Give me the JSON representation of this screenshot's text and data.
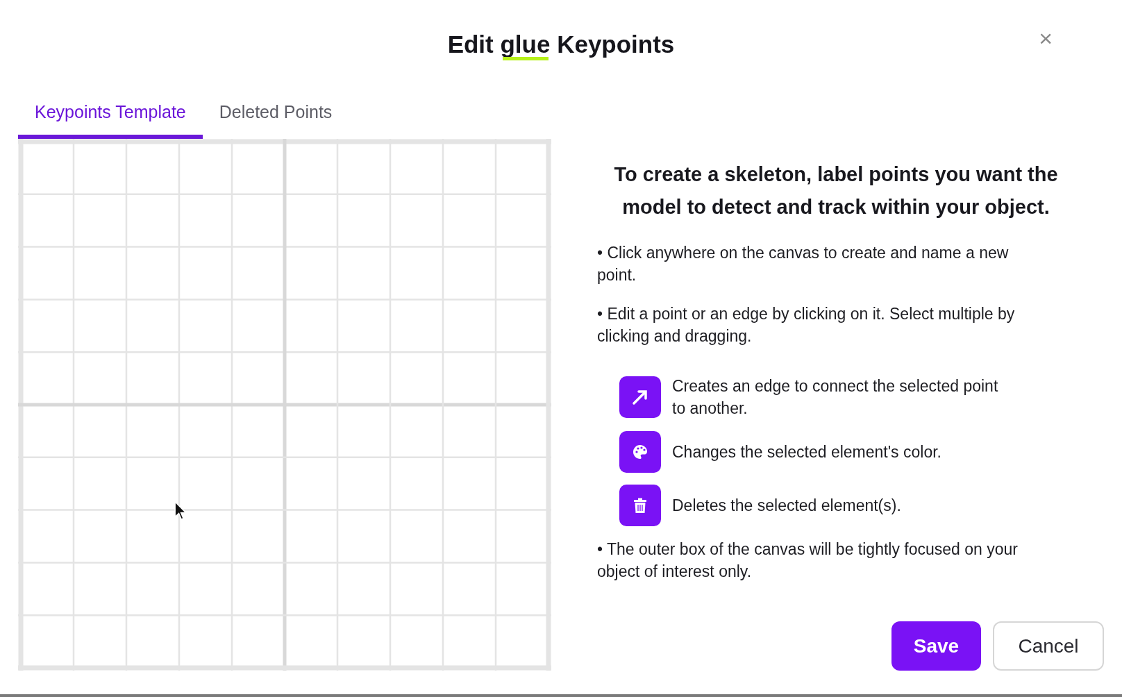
{
  "dialog": {
    "title_parts": [
      {
        "text": "Edit "
      },
      {
        "text": "glue",
        "underlined": true
      },
      {
        "text": " Keypoints"
      }
    ],
    "close": "×"
  },
  "tabs": [
    {
      "label": "Keypoints Template",
      "selected": true
    },
    {
      "label": "Deleted Points",
      "selected": false
    }
  ],
  "instructions": {
    "heading": "To create a skeleton, label points you want the model to detect and track within your object.",
    "items": [
      {
        "kind": "bullet",
        "text": "• Click anywhere on the canvas to create and name a new point."
      },
      {
        "kind": "bullet",
        "text": "• Edit a point or an edge by clicking on it. Select multiple by clicking and dragging."
      },
      {
        "kind": "edge_tool",
        "text": "Creates an edge to connect the selected point to another."
      },
      {
        "kind": "color_tool",
        "text": "Changes the selected element's color."
      },
      {
        "kind": "delete_tool",
        "text": "Deletes the selected element(s)."
      },
      {
        "kind": "bullet",
        "text": "• The outer box of the canvas will be tightly focused on your object of interest only."
      }
    ]
  },
  "buttons": [
    {
      "label": "Save",
      "kind": "primary"
    },
    {
      "label": "Cancel",
      "kind": "secondary"
    }
  ]
}
